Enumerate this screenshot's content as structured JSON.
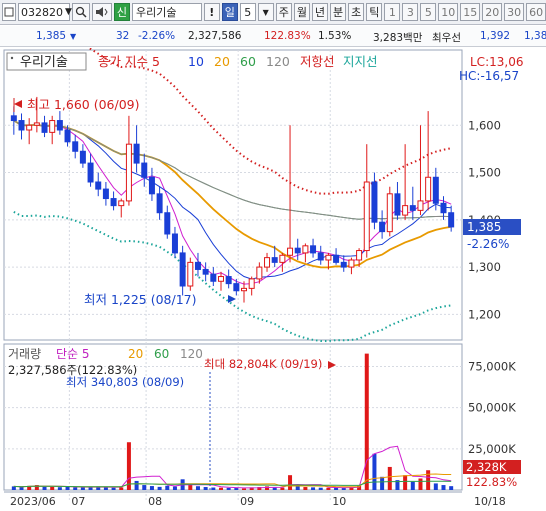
{
  "toolbar": {
    "code": "032820",
    "dropdown_arrow": "▼",
    "search_icon": "search-icon",
    "alt_mark": "신",
    "stock_name": "우리기술",
    "alert_mark": "!",
    "period_label": "일",
    "period_value": "5",
    "tabs": [
      "주",
      "월",
      "년",
      "분",
      "초",
      "틱"
    ],
    "numbers": [
      "1",
      "3",
      "5",
      "10",
      "15",
      "20",
      "30",
      "60"
    ]
  },
  "pricebar": {
    "price": "1,385",
    "change": "32",
    "change_pct": "-2.26%",
    "volume": "2,327,586",
    "volume_pct": "122.83%",
    "turnover": "1.53%",
    "amount": "3,283백만",
    "name2": "최우선",
    "ask": "1,392",
    "bid": "1,38"
  },
  "chart_data": {
    "type": "candlestick",
    "price_panel": {
      "legend": {
        "stock": "우리기술",
        "ma_title": "종가 지수 5",
        "ma_periods": [
          {
            "label": "10",
            "color": "#1a3fd6"
          },
          {
            "label": "20",
            "color": "#e89a00"
          },
          {
            "label": "60",
            "color": "#2f9e4a"
          },
          {
            "label": "120",
            "color": "#8a8a8a"
          }
        ],
        "resistance": "저항선",
        "support": "지지선"
      },
      "ylim": [
        1150,
        1700
      ],
      "yticks": [
        "1,600",
        "1,500",
        "1,400",
        "1,300",
        "1,200"
      ],
      "lc": "LC:13,06",
      "hc": "HC:-16,57",
      "high_annotation": "최고 1,660 (06/09)",
      "low_annotation": "최저 1,225 (08/17)",
      "current_price": "1,385",
      "current_change": "-2.26%",
      "candles": [
        [
          1620,
          1640,
          1580,
          1610
        ],
        [
          1610,
          1625,
          1570,
          1590
        ],
        [
          1590,
          1615,
          1560,
          1600
        ],
        [
          1600,
          1660,
          1585,
          1605
        ],
        [
          1605,
          1620,
          1575,
          1585
        ],
        [
          1585,
          1620,
          1560,
          1610
        ],
        [
          1610,
          1630,
          1580,
          1590
        ],
        [
          1590,
          1600,
          1555,
          1565
        ],
        [
          1565,
          1580,
          1530,
          1545
        ],
        [
          1545,
          1560,
          1510,
          1520
        ],
        [
          1520,
          1540,
          1470,
          1480
        ],
        [
          1480,
          1500,
          1450,
          1465
        ],
        [
          1465,
          1480,
          1430,
          1445
        ],
        [
          1445,
          1460,
          1420,
          1430
        ],
        [
          1430,
          1445,
          1405,
          1440
        ],
        [
          1440,
          1620,
          1430,
          1560
        ],
        [
          1560,
          1600,
          1500,
          1520
        ],
        [
          1520,
          1540,
          1470,
          1490
        ],
        [
          1490,
          1510,
          1440,
          1455
        ],
        [
          1455,
          1470,
          1400,
          1415
        ],
        [
          1415,
          1430,
          1360,
          1370
        ],
        [
          1370,
          1385,
          1320,
          1330
        ],
        [
          1330,
          1345,
          1240,
          1260
        ],
        [
          1260,
          1320,
          1250,
          1310
        ],
        [
          1310,
          1330,
          1280,
          1295
        ],
        [
          1295,
          1310,
          1270,
          1285
        ],
        [
          1285,
          1300,
          1260,
          1270
        ],
        [
          1270,
          1290,
          1250,
          1280
        ],
        [
          1280,
          1295,
          1255,
          1265
        ],
        [
          1265,
          1275,
          1240,
          1250
        ],
        [
          1250,
          1270,
          1225,
          1255
        ],
        [
          1255,
          1280,
          1240,
          1275
        ],
        [
          1275,
          1310,
          1265,
          1300
        ],
        [
          1300,
          1330,
          1290,
          1320
        ],
        [
          1320,
          1345,
          1300,
          1310
        ],
        [
          1310,
          1330,
          1290,
          1325
        ],
        [
          1325,
          1600,
          1310,
          1340
        ],
        [
          1340,
          1360,
          1315,
          1330
        ],
        [
          1330,
          1350,
          1310,
          1345
        ],
        [
          1345,
          1360,
          1320,
          1330
        ],
        [
          1330,
          1345,
          1305,
          1315
        ],
        [
          1315,
          1330,
          1295,
          1325
        ],
        [
          1325,
          1340,
          1305,
          1310
        ],
        [
          1310,
          1325,
          1290,
          1300
        ],
        [
          1300,
          1320,
          1285,
          1315
        ],
        [
          1315,
          1340,
          1300,
          1335
        ],
        [
          1335,
          1560,
          1320,
          1480
        ],
        [
          1480,
          1500,
          1380,
          1395
        ],
        [
          1395,
          1420,
          1360,
          1375
        ],
        [
          1375,
          1470,
          1365,
          1455
        ],
        [
          1455,
          1480,
          1400,
          1410
        ],
        [
          1410,
          1560,
          1400,
          1430
        ],
        [
          1430,
          1470,
          1400,
          1420
        ],
        [
          1420,
          1600,
          1410,
          1440
        ],
        [
          1440,
          1630,
          1420,
          1490
        ],
        [
          1490,
          1510,
          1420,
          1435
        ],
        [
          1435,
          1450,
          1400,
          1415
        ],
        [
          1415,
          1430,
          1375,
          1385
        ]
      ]
    },
    "volume_panel": {
      "legend": {
        "title": "거래량",
        "ma_title": "단순 5",
        "ma_periods": [
          {
            "label": "20",
            "color": "#e89a00"
          },
          {
            "label": "60",
            "color": "#2f9e4a"
          },
          {
            "label": "120",
            "color": "#8a8a8a"
          }
        ]
      },
      "volume_text": "2,327,586주(122.83%)",
      "max_annotation": "최대 82,804K (09/19)",
      "min_annotation": "최저 340,803 (08/09)",
      "ylim": [
        0,
        85000
      ],
      "yticks": [
        "75,000K",
        "50,000K",
        "25,000K"
      ],
      "current_volume": "2,328K",
      "current_pct": "122.83%",
      "volumes_k": [
        2200,
        1800,
        2500,
        3000,
        2000,
        1900,
        1700,
        2100,
        1600,
        1500,
        1800,
        2200,
        1700,
        1400,
        1600,
        29000,
        5500,
        3000,
        2400,
        1900,
        2600,
        2100,
        6500,
        3000,
        2300,
        1800,
        1500,
        1400,
        1300,
        1200,
        900,
        1600,
        1800,
        2200,
        1500,
        1400,
        9000,
        2500,
        1800,
        1600,
        1400,
        1300,
        1500,
        1200,
        1800,
        2500,
        82804,
        22000,
        8000,
        14000,
        6000,
        9000,
        5000,
        7000,
        12000,
        4000,
        3000,
        2328
      ]
    },
    "x_labels": [
      "2023/06",
      "07",
      "08",
      "09",
      "10",
      "10/18"
    ]
  }
}
